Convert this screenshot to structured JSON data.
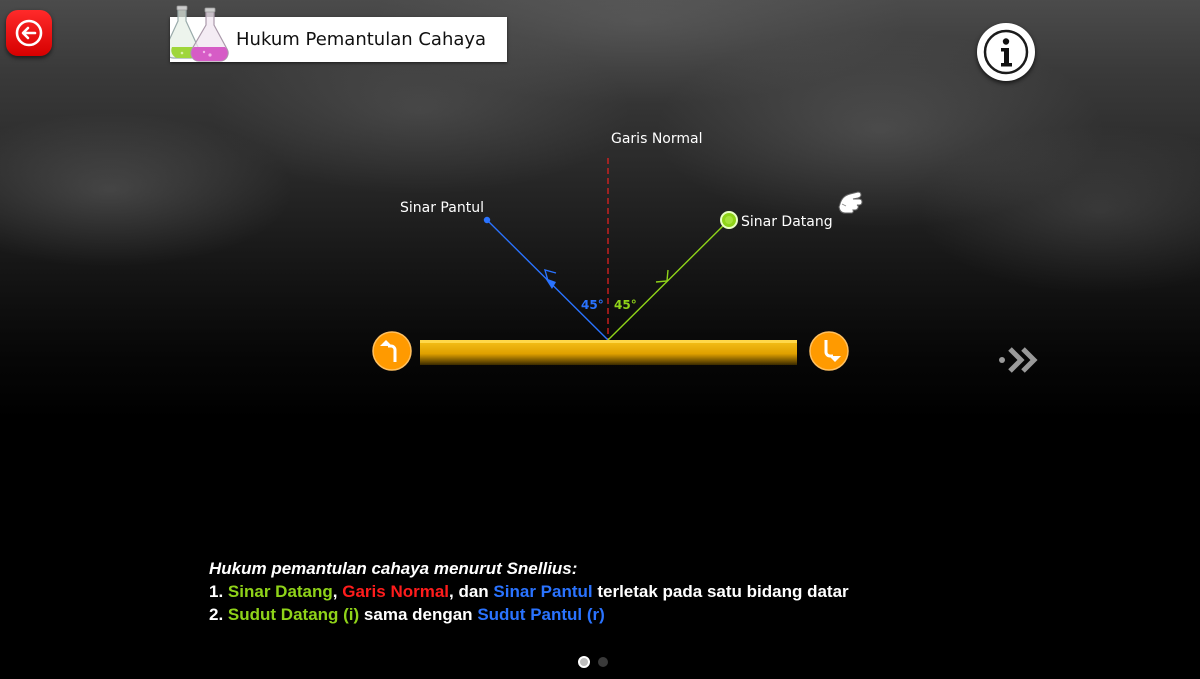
{
  "header": {
    "title": "Hukum Pemantulan Cahaya"
  },
  "icons": {
    "back": "back-arrow-icon",
    "flask": "flask-icon",
    "info": "info-icon",
    "next": "next-arrow-icon",
    "rotate_left": "rotate-left-icon",
    "rotate_right": "rotate-right-icon",
    "hand": "pointing-hand-icon"
  },
  "diagram": {
    "normal_label": "Garis Normal",
    "reflected_label": "Sinar Pantul",
    "incident_label": "Sinar Datang",
    "reflected_angle": "45°",
    "incident_angle": "45°"
  },
  "law": {
    "heading": "Hukum pemantulan cahaya menurut Snellius:",
    "line1": {
      "num": "1.",
      "incident": "Sinar Datang",
      "comma1": ",",
      "normal": "Garis Normal",
      "mid": ", dan",
      "reflected": "Sinar Pantul",
      "rest": "terletak pada satu bidang datar"
    },
    "line2": {
      "num": "2.",
      "incident_angle": "Sudut Datang (i)",
      "mid": "sama dengan",
      "reflected_angle": "Sudut Pantul (r)"
    }
  },
  "pager": {
    "total": 2,
    "current": 1
  },
  "colors": {
    "incident": "#8fd319",
    "normal": "#ff1c1c",
    "reflected": "#2a73ff",
    "mirror": "#f5b400",
    "knob": "#ff9a00",
    "back_button": "#e60000"
  }
}
